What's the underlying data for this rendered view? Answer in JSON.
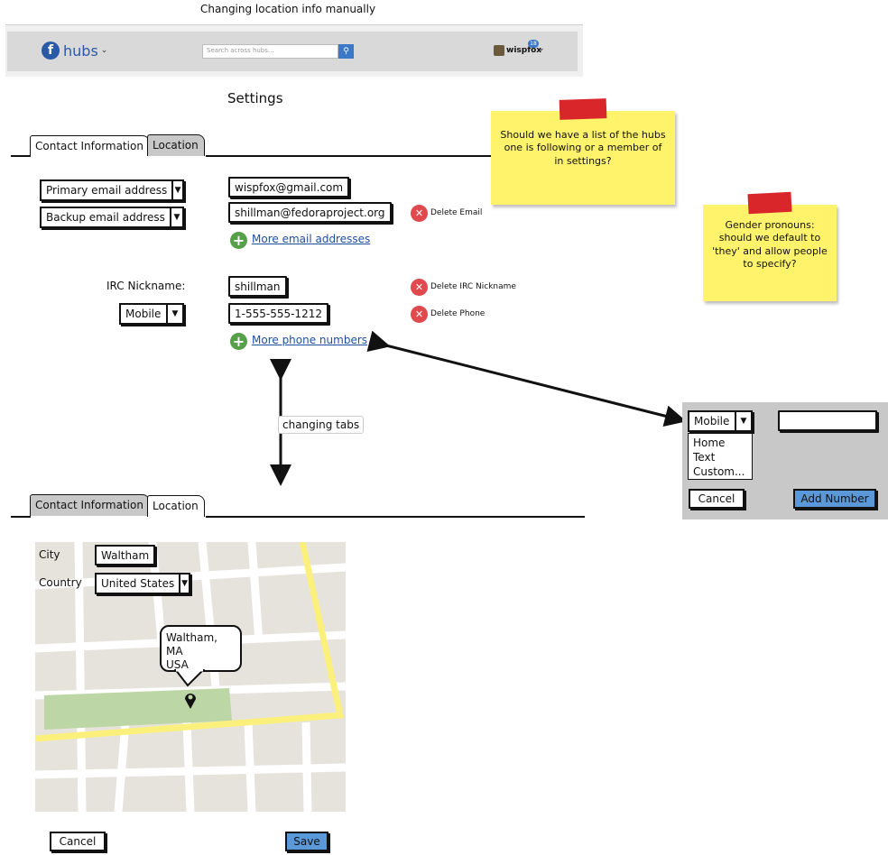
{
  "page_title": "Changing location info manually",
  "header": {
    "logo_text": "hubs",
    "search_placeholder": "Search across hubs...",
    "username": "wispfox",
    "notification_count": "18"
  },
  "settings_title": "Settings",
  "tabs": {
    "contact": "Contact Information",
    "location": "Location"
  },
  "contact": {
    "email_type_1": "Primary email address",
    "email_1": "wispfox@gmail.com",
    "email_type_2": "Backup email address",
    "email_2": "shillman@fedoraproject.org",
    "delete_email": "Delete Email",
    "more_emails": "More email addresses",
    "irc_label": "IRC Nickname:",
    "irc_value": "shillman",
    "delete_irc": "Delete IRC Nickname",
    "phone_type": "Mobile",
    "phone_value": "1-555-555-1212",
    "delete_phone": "Delete Phone",
    "more_phones": "More phone numbers"
  },
  "annotation_changing_tabs": "changing tabs",
  "notes": {
    "note1": "Should we have a list of the hubs one is following or a member of in settings?",
    "note2": "Gender pronouns: should we default to 'they' and allow people to specify?"
  },
  "phone_popup": {
    "type_selected": "Mobile",
    "options": [
      "Home",
      "Text",
      "Custom..."
    ],
    "cancel": "Cancel",
    "add": "Add Number"
  },
  "location": {
    "city_label": "City",
    "city_value": "Waltham",
    "country_label": "Country",
    "country_value": "United States",
    "bubble_line1": "Waltham, MA",
    "bubble_line2": "USA"
  },
  "footer_buttons": {
    "cancel": "Cancel",
    "save": "Save"
  },
  "colors": {
    "header_bg": "#d9d9d9",
    "link": "#1f4fa0",
    "sticky": "#fef36b",
    "primary_button": "#5a98d8",
    "map_bg": "#e6e3dc",
    "map_park": "#bcd7a5",
    "map_road_major": "#fbf07c"
  }
}
